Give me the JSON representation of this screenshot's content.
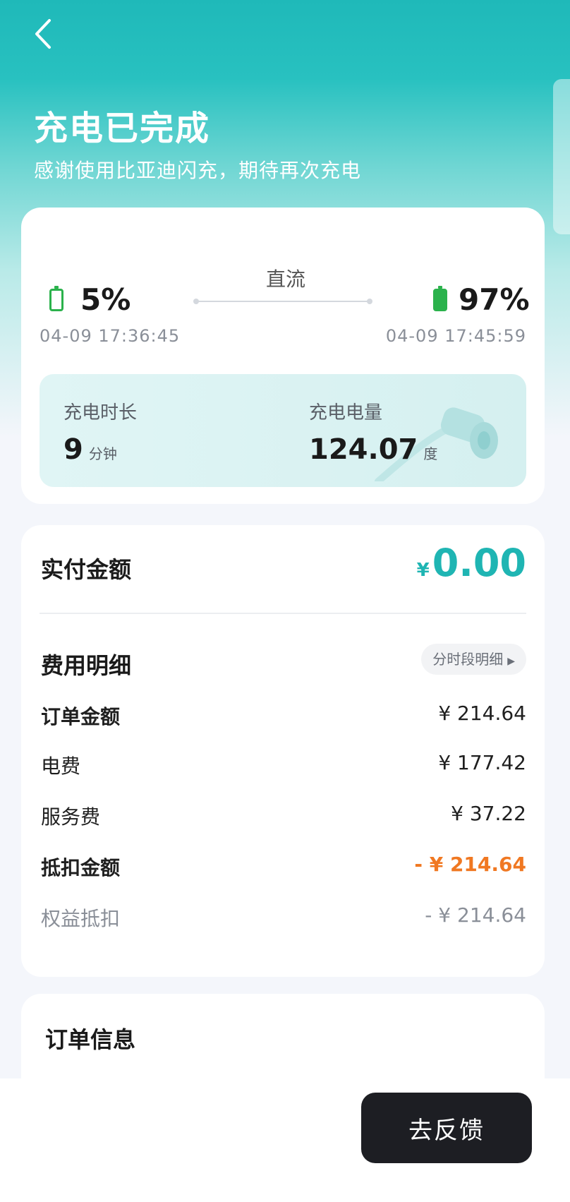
{
  "header": {
    "title": "充电已完成",
    "subtitle": "感谢使用比亚迪闪充，期待再次充电"
  },
  "charging": {
    "mode": "直流",
    "start": {
      "percent": "5%",
      "time": "04-09 17:36:45"
    },
    "end": {
      "percent": "97%",
      "time": "04-09 17:45:59"
    },
    "duration": {
      "label": "充电时长",
      "value": "9",
      "unit": "分钟"
    },
    "energy": {
      "label": "充电电量",
      "value": "124.07",
      "unit": "度"
    }
  },
  "payment": {
    "label": "实付金额",
    "currency": "¥",
    "amount": "0.00",
    "color": "#1fb5b3"
  },
  "fees": {
    "title": "费用明细",
    "period_button": "分时段明细",
    "rows": [
      {
        "label": "订单金额",
        "value": "¥ 214.64"
      },
      {
        "label": "电费",
        "value": "¥ 177.42"
      },
      {
        "label": "服务费",
        "value": "¥ 37.22"
      },
      {
        "label": "抵扣金额",
        "value": "- ¥ 214.64"
      },
      {
        "label": "权益抵扣",
        "value": "- ¥ 214.64"
      }
    ]
  },
  "order": {
    "title": "订单信息"
  },
  "footer": {
    "feedback_button": "去反馈"
  },
  "icons": {
    "back": "chevron-left-icon",
    "battery_low": "battery-low-icon",
    "battery_full": "battery-full-icon",
    "arrow": "triangle-right-icon"
  }
}
